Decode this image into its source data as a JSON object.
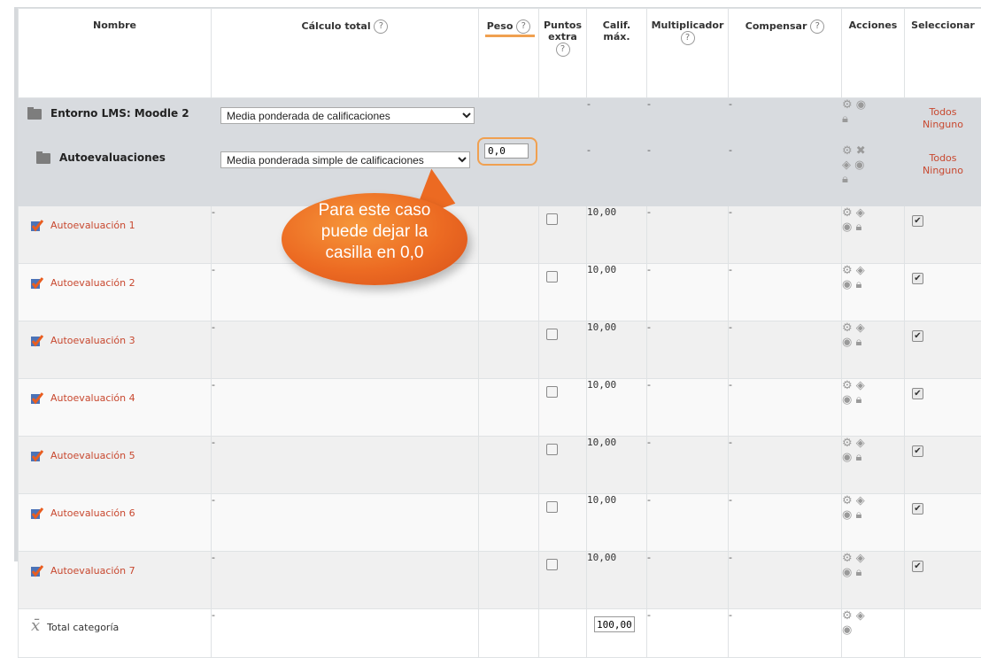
{
  "headers": {
    "nombre": "Nombre",
    "calculo": "Cálculo total",
    "peso": "Peso",
    "puntos": [
      "Puntos",
      "extra"
    ],
    "calif": [
      "Calif.",
      "máx."
    ],
    "multiplicador": "Multiplicador",
    "compensar": "Compensar",
    "acciones": "Acciones",
    "seleccionar": "Seleccionar"
  },
  "help_icon": "?",
  "categories": [
    {
      "name": "Entorno LMS: Moodle 2",
      "calc": "Media ponderada de calificaciones",
      "dash": "-",
      "todos": "Todos",
      "ninguno": "Ninguno"
    },
    {
      "name": "Autoevaluaciones",
      "calc": "Media ponderada simple de calificaciones",
      "peso": "0,0",
      "dash": "-",
      "todos": "Todos",
      "ninguno": "Ninguno"
    }
  ],
  "items": [
    {
      "name": "Autoevaluación 1",
      "dash": "-",
      "max": "10,00"
    },
    {
      "name": "Autoevaluación 2",
      "dash": "-",
      "max": "10,00"
    },
    {
      "name": "Autoevaluación 3",
      "dash": "-",
      "max": "10,00"
    },
    {
      "name": "Autoevaluación 4",
      "dash": "-",
      "max": "10,00"
    },
    {
      "name": "Autoevaluación 5",
      "dash": "-",
      "max": "10,00"
    },
    {
      "name": "Autoevaluación 6",
      "dash": "-",
      "max": "10,00"
    },
    {
      "name": "Autoevaluación 7",
      "dash": "-",
      "max": "10,00"
    }
  ],
  "total": {
    "name": "Total categoría",
    "dash": "-",
    "max": "100,00"
  },
  "callout": [
    "Para este caso",
    "puede dejar la",
    "casilla en 0,0"
  ],
  "icons": {
    "gear": "gear-icon",
    "eye": "eye-icon",
    "lock": "lock-icon",
    "edit": "edit-icon",
    "delete": "delete-icon",
    "checkmark": "checkmark-icon",
    "folder": "folder-icon"
  },
  "colors": {
    "link": "#c8482f",
    "accent": "#f0a050",
    "callout": "#ec6a22"
  }
}
